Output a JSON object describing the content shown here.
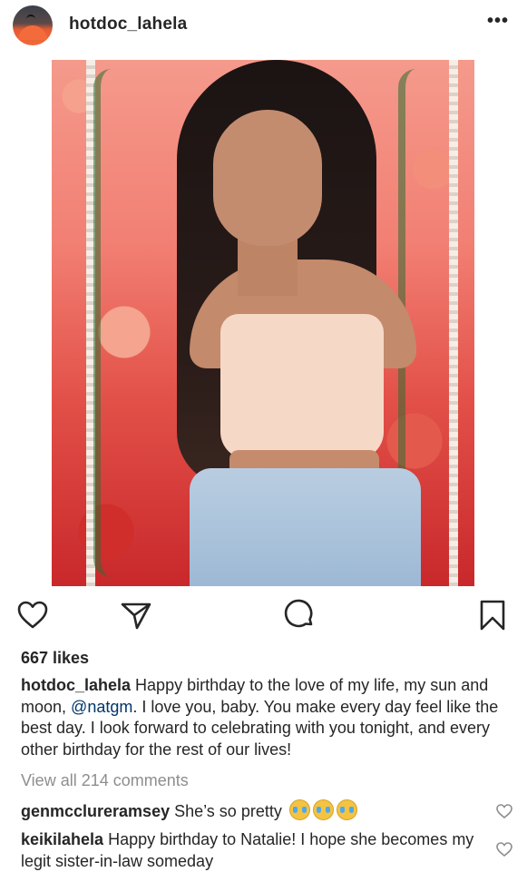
{
  "post": {
    "username": "hotdoc_lahela",
    "more_label": "•••",
    "likes": "667 likes",
    "caption": {
      "user": "hotdoc_lahela",
      "text_part1": "Happy birthday to the love of my life, my sun and moon,",
      "mention": "@natgm",
      "text_part2": ". I love you, baby. You make every day feel like the best day. I look forward to celebrating with you tonight, and every other birthday for the rest of our lives!"
    },
    "view_all_comments": "View all 214 comments",
    "comments": [
      {
        "user": "genmcclureramsey",
        "text": "She’s so pretty",
        "emoji": "😭😭😭"
      },
      {
        "user": "keikilahela",
        "text": "Happy birthday to Natalie! I hope she becomes my legit sister-in-law someday"
      }
    ]
  },
  "icons": {
    "avatar": "profile-avatar",
    "more": "more-options-icon",
    "like": "heart-icon",
    "comment": "comment-icon",
    "share": "share-icon",
    "save": "bookmark-icon",
    "comment_like": "small-heart-icon"
  },
  "colors": {
    "text": "#262626",
    "muted": "#8e8e8e",
    "mention": "#003569"
  }
}
